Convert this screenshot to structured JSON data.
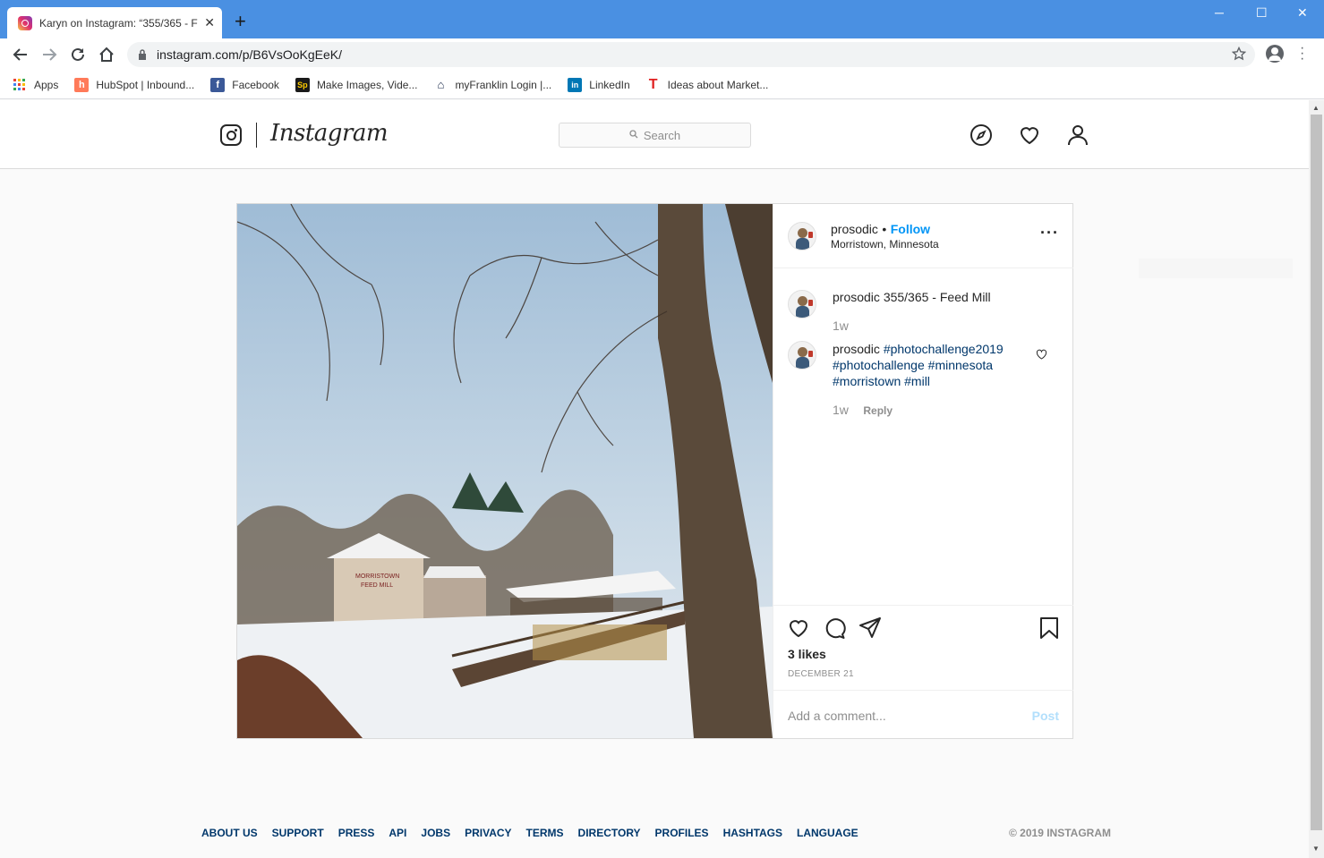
{
  "browser": {
    "tab_title": "Karyn on Instagram: “355/365 - F",
    "url": "instagram.com/p/B6VsOoKgEeK/",
    "bookmarks": [
      {
        "label": "Apps",
        "icon": "apps-grid-icon"
      },
      {
        "label": "HubSpot | Inbound...",
        "icon": "hubspot-icon"
      },
      {
        "label": "Facebook",
        "icon": "facebook-icon"
      },
      {
        "label": "Make Images, Vide...",
        "icon": "spark-icon"
      },
      {
        "label": "myFranklin Login |...",
        "icon": "franklin-icon"
      },
      {
        "label": "LinkedIn",
        "icon": "linkedin-icon"
      },
      {
        "label": "Ideas about Market...",
        "icon": "t-icon"
      }
    ]
  },
  "instagram": {
    "wordmark": "Instagram",
    "search_placeholder": "Search"
  },
  "post": {
    "username": "prosodic",
    "separator": "•",
    "follow_label": "Follow",
    "location": "Morristown, Minnesota",
    "caption": {
      "username": "prosodic",
      "text": "355/365 - Feed Mill",
      "time": "1w"
    },
    "comment": {
      "username": "prosodic",
      "tags": [
        "#photochallenge2019",
        "#photochallenge",
        "#minnesota",
        "#morristown",
        "#mill"
      ],
      "time": "1w",
      "reply_label": "Reply"
    },
    "likes": "3 likes",
    "date": "DECEMBER 21",
    "comment_placeholder": "Add a comment...",
    "post_label": "Post"
  },
  "footer": {
    "links": [
      "ABOUT US",
      "SUPPORT",
      "PRESS",
      "API",
      "JOBS",
      "PRIVACY",
      "TERMS",
      "DIRECTORY",
      "PROFILES",
      "HASHTAGS",
      "LANGUAGE"
    ],
    "copyright": "© 2019 INSTAGRAM"
  },
  "colors": {
    "chrome_titlebar": "#4a90e2",
    "follow": "#0095f6",
    "hashtag": "#00376b",
    "post_disabled": "#b2dffc"
  }
}
